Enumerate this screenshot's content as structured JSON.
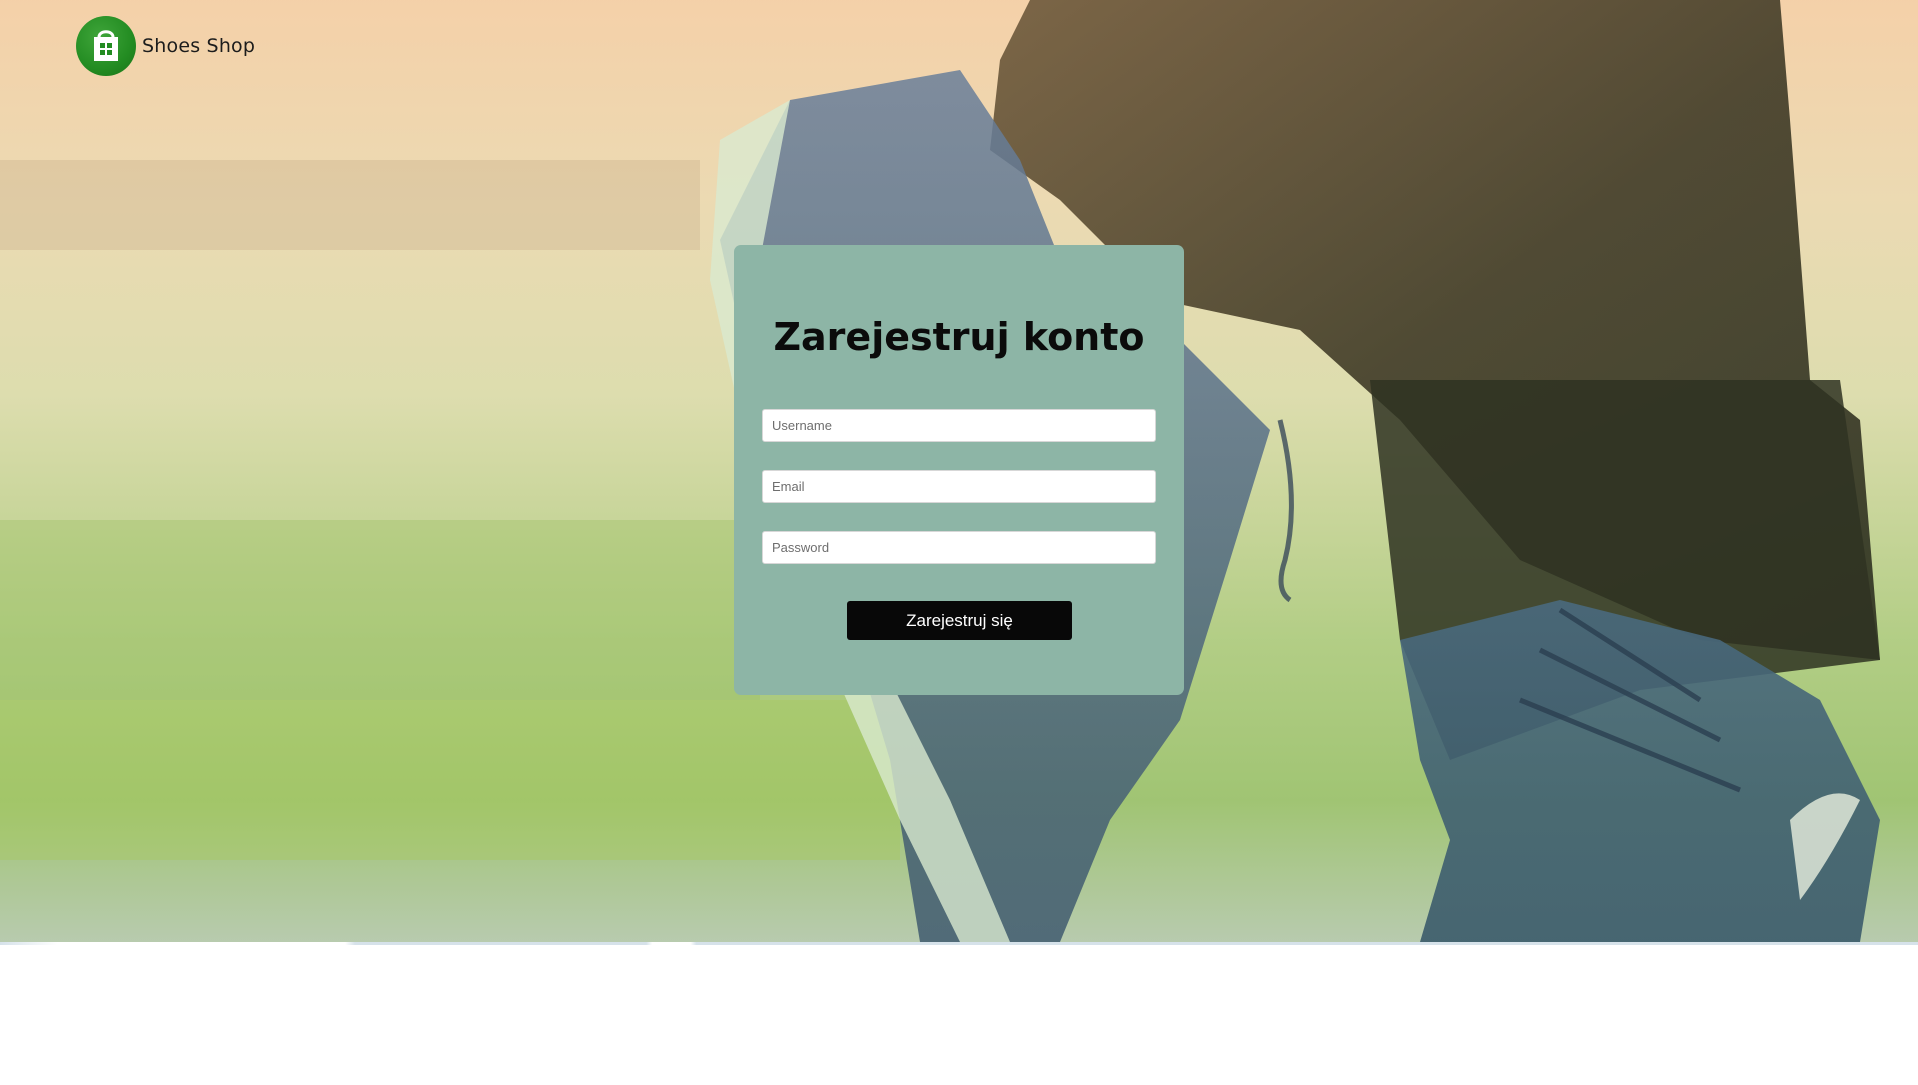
{
  "brand": {
    "name": "Shoes Shop",
    "logo_icon": "shopping-bag-windows-icon",
    "logo_color": "#238c22"
  },
  "register_form": {
    "title": "Zarejestruj konto",
    "username_placeholder": "Username",
    "email_placeholder": "Email",
    "password_placeholder": "Password",
    "submit_label": "Zarejestruj się",
    "card_color": "#8db5a6",
    "button_color": "#080808"
  },
  "background": {
    "image_subject": "sneakers",
    "tint": "#f4cea4"
  }
}
